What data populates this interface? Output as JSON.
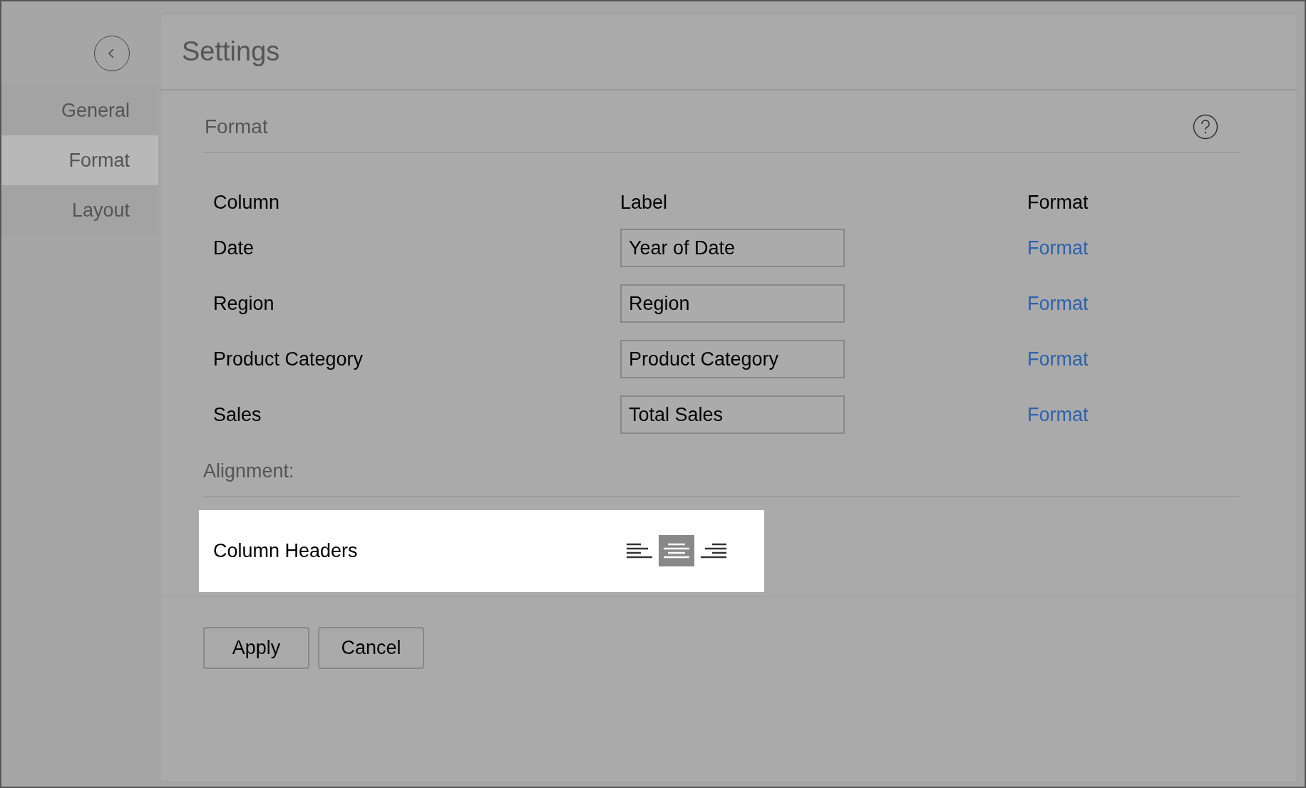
{
  "sidebar": {
    "items": [
      {
        "label": "General",
        "selected": false
      },
      {
        "label": "Format",
        "selected": true
      },
      {
        "label": "Layout",
        "selected": false
      }
    ]
  },
  "header": {
    "title": "Settings"
  },
  "section": {
    "title": "Format"
  },
  "table": {
    "columns": [
      "Column",
      "Label",
      "Format"
    ],
    "rows": [
      {
        "column": "Date",
        "label": "Year of Date",
        "action": "Format"
      },
      {
        "column": "Region",
        "label": "Region",
        "action": "Format"
      },
      {
        "column": "Product Category",
        "label": "Product Category",
        "action": "Format"
      },
      {
        "column": "Sales",
        "label": "Total Sales",
        "action": "Format"
      }
    ]
  },
  "alignment": {
    "title": "Alignment:",
    "row_label": "Column Headers",
    "options": [
      {
        "kind": "left",
        "selected": false
      },
      {
        "kind": "center",
        "selected": true
      },
      {
        "kind": "right",
        "selected": false
      }
    ]
  },
  "buttons": [
    "Apply",
    "Cancel"
  ]
}
